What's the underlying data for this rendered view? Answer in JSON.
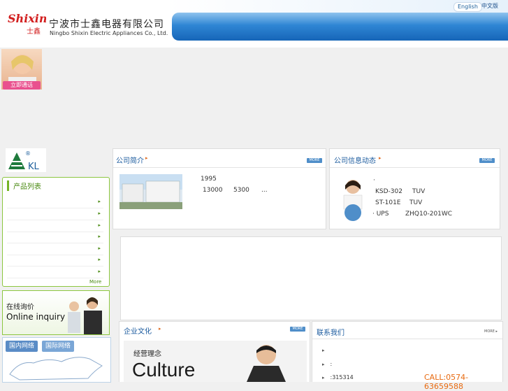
{
  "header": {
    "brand_script": "Shixin",
    "brand_cn_sub": "士鑫",
    "company_cn": "宁波市士鑫电器有限公司",
    "company_en": "Ningbo Shixin Electric Appliances Co., Ltd.",
    "lang_en": "English",
    "lang_cn": "中文版"
  },
  "call": {
    "button": "立即通话"
  },
  "kl_logo": {
    "text": "KL",
    "mark": "®"
  },
  "products": {
    "title": "产品列表",
    "rows": [
      "",
      "",
      "",
      "",
      "",
      "",
      ""
    ],
    "more": "More"
  },
  "inquiry": {
    "cn": "在线询价",
    "en": "Online inquiry"
  },
  "map": {
    "tab_domestic": "国内网络",
    "tab_international": "国际网络"
  },
  "about": {
    "title": "公司简介",
    "more": "MORE",
    "line1": "1995",
    "line2_a": "13000",
    "line2_b": "5300",
    "line2_c": "..."
  },
  "news": {
    "title": "公司信息动态",
    "more": "MORE",
    "dot": "·",
    "items": [
      {
        "a": "KSD-302",
        "b": "TUV"
      },
      {
        "a": "ST-101E",
        "b": "TUV"
      },
      {
        "a": "· UPS",
        "b": "ZHQ10-201WC"
      }
    ]
  },
  "culture": {
    "title": "企业文化",
    "more": "MORE",
    "banner_cn": "经营理念",
    "banner_en": "Culture"
  },
  "contact": {
    "title": "联系我们",
    "more": "MORE",
    "rows": [
      "",
      ":",
      ":315314"
    ],
    "call": "CALL:0574-63659588"
  },
  "colors": {
    "accent_blue": "#2f86d4",
    "green": "#74b324",
    "orange": "#e06a1e"
  }
}
